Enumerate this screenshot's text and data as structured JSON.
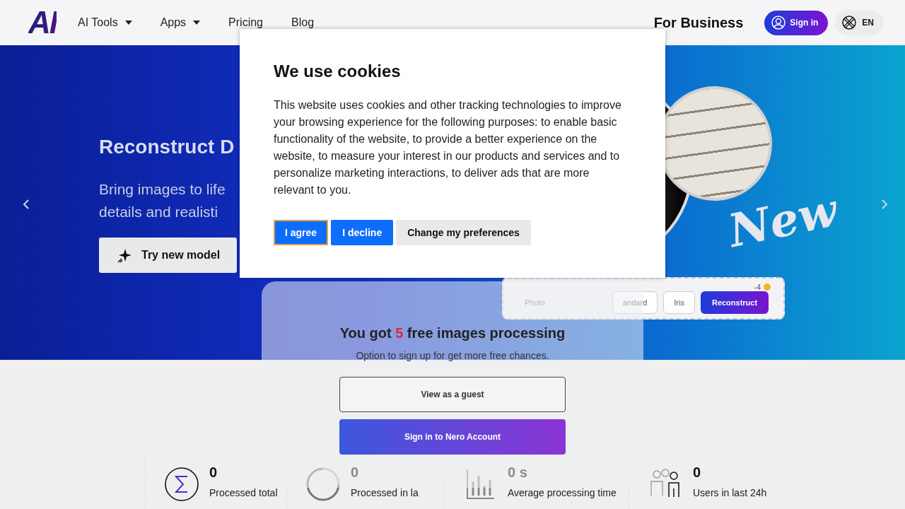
{
  "nav": {
    "logo": "AI",
    "items": [
      {
        "label": "AI Tools",
        "dropdown": true
      },
      {
        "label": "Apps",
        "dropdown": true
      },
      {
        "label": "Pricing",
        "dropdown": false
      },
      {
        "label": "Blog",
        "dropdown": false
      }
    ],
    "business": "For Business",
    "sign_in": "Sign in",
    "language": "EN"
  },
  "hero": {
    "title": "Reconstruct D",
    "subtitle": [
      "Bring images to life",
      "details and realisti"
    ],
    "button": "Try new model",
    "badge": "New",
    "demo": {
      "cost": "-4",
      "options": [
        {
          "label": "Photo",
          "kind": "plain"
        },
        {
          "label": "andard",
          "kind": "outlined"
        },
        {
          "label": "Iris",
          "kind": "outlined"
        },
        {
          "label": "Reconstruct",
          "kind": "primary"
        }
      ]
    }
  },
  "stats": [
    {
      "kind": "sum",
      "value": "0",
      "label": "Processed total"
    },
    {
      "kind": "clock",
      "value": "0",
      "label": "Processed in la"
    },
    {
      "kind": "chart",
      "value": "0 s",
      "label": "Average processing time"
    },
    {
      "kind": "users",
      "value": "0",
      "label": "Users in last 24h"
    }
  ],
  "login_panel": {
    "headline_before": "You got ",
    "count": "5",
    "headline_after": " free images processing",
    "note": "Option to sign up for get more free chances.",
    "guest_button": "View as a guest",
    "sign_in_button": "Sign in to Nero Account"
  },
  "cookie_dialog": {
    "title": "We use cookies",
    "body": "This website uses cookies and other tracking technologies to improve your browsing experience for the following purposes: to enable basic functionality of the website, to provide a better experience on the website, to measure your interest in our products and services and to personalize marketing interactions, to deliver ads that are more relevant to you.",
    "buttons": [
      {
        "label": "I agree",
        "kind": "primary",
        "focused": true
      },
      {
        "label": "I decline",
        "kind": "primary",
        "focused": false
      },
      {
        "label": "Change my preferences",
        "kind": "secondary",
        "focused": false
      }
    ]
  }
}
